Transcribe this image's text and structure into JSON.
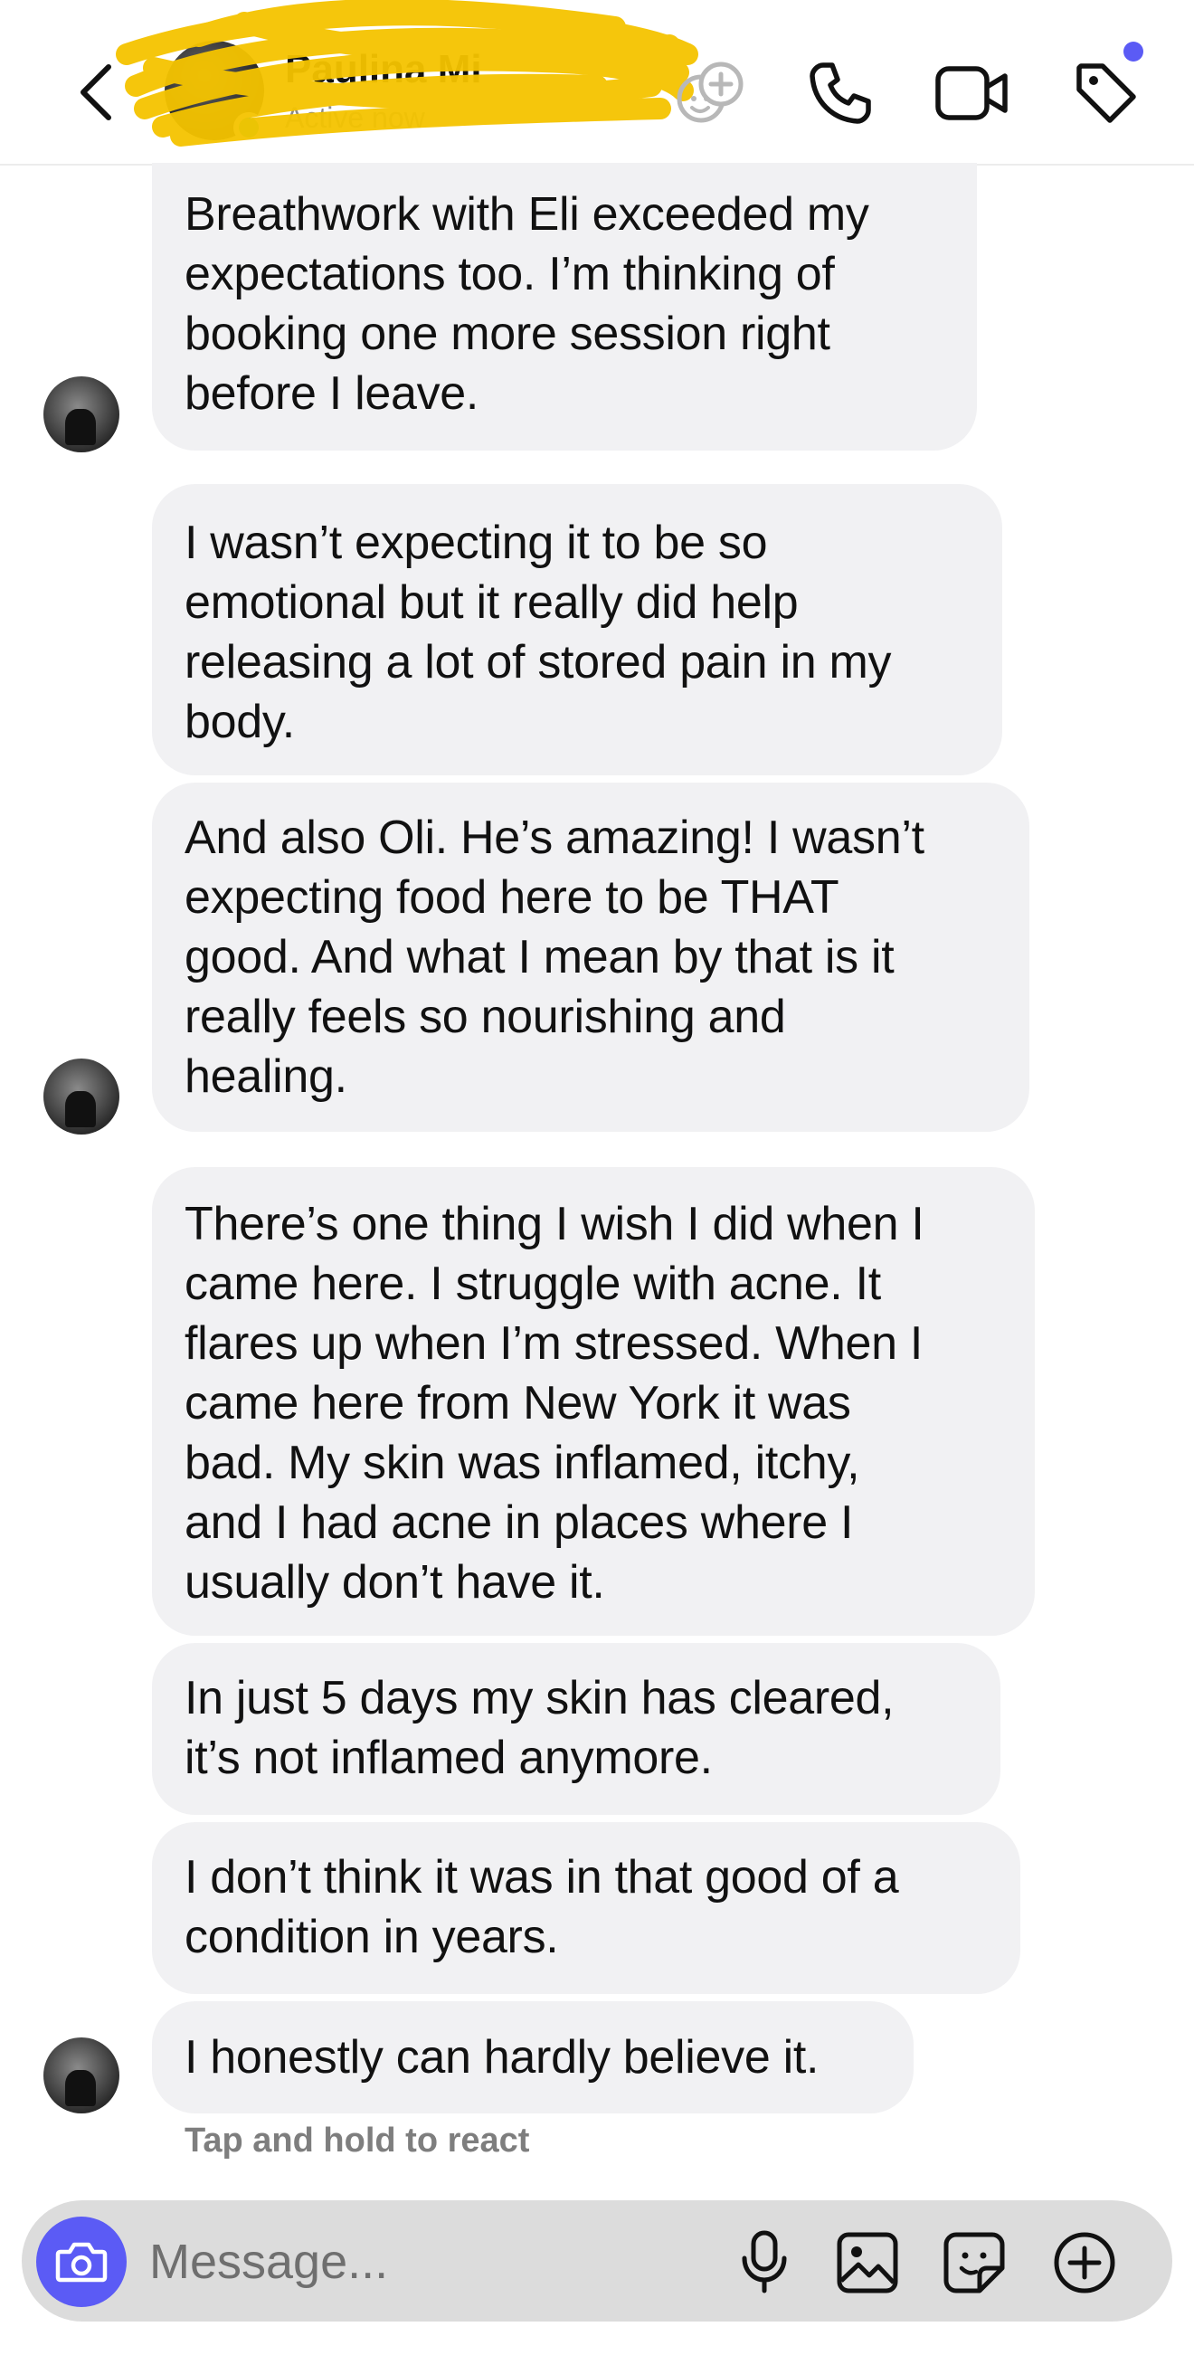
{
  "header": {
    "contact_name": "Paulina Mi",
    "status": "Active now"
  },
  "messages": [
    {
      "lines": [
        "Breathwork with Eli exceeded my",
        "expectations too. I’m thinking of",
        "booking one more session right",
        "before I leave."
      ]
    },
    {
      "lines": [
        "I wasn’t expecting it to be so",
        "emotional but it really did help",
        "releasing a lot of stored pain in my",
        "body."
      ]
    },
    {
      "lines": [
        "And also Oli. He’s amazing! I wasn’t",
        "expecting food here to be THAT",
        "good. And what I mean by that is it",
        "really feels so nourishing and",
        "healing."
      ]
    },
    {
      "lines": [
        "There’s one thing I wish I did when I",
        "came here. I struggle with acne. It",
        "flares up when I’m stressed. When I",
        "came here from New York it was",
        "bad. My skin was inflamed, itchy,",
        "and I had acne in places where I",
        "usually don’t have it."
      ]
    },
    {
      "lines": [
        "In just 5 days my skin has cleared,",
        "it’s not inflamed anymore."
      ]
    },
    {
      "lines": [
        "I don’t think it was in that good of a",
        "condition in years."
      ]
    },
    {
      "lines": [
        "I honestly can hardly believe it."
      ]
    }
  ],
  "hint": "Tap and hold to react",
  "composer": {
    "placeholder": "Message..."
  },
  "colors": {
    "accent": "#5b5bf5",
    "bubble": "#f1f1f3",
    "online": "#34c759",
    "scribble": "#f5c400"
  },
  "icons": [
    "back-chevron-icon",
    "add-people-icon",
    "phone-icon",
    "video-icon",
    "tag-icon",
    "camera-icon",
    "microphone-icon",
    "gallery-icon",
    "sticker-icon",
    "plus-icon"
  ]
}
